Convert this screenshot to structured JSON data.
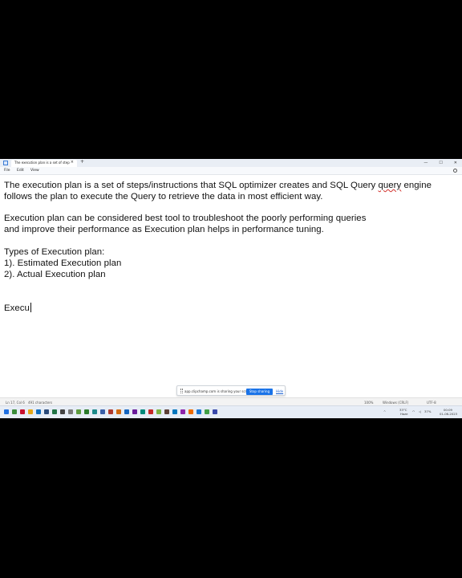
{
  "window": {
    "tab_title": "The execution plan is a set of step",
    "tab_close": "×",
    "new_tab": "+",
    "minimize": "—",
    "maximize": "☐",
    "close": "✕"
  },
  "menu": {
    "items": [
      "File",
      "Edit",
      "View"
    ]
  },
  "editor": {
    "lines": [
      "The execution plan is a set of steps/instructions that SQL optimizer creates and SQL Query ",
      "follows the plan to execute the Query to retrieve the data in most efficient way.",
      "Execution plan can be considered best tool to troubleshoot the poorly performing queries",
      "and improve their performance as Execution plan helps in performance tuning.",
      "Types of Execution plan:",
      "1). Estimated Execution plan",
      "2). Actual Execution plan",
      "Execu"
    ],
    "line0_squiggle": "query",
    "line0_tail": " engine"
  },
  "share_banner": {
    "text": "app.clipchamp.com is sharing your screen.",
    "stop_label": "Stop sharing",
    "hide_label": "Hide"
  },
  "status": {
    "position": "Ln 17, Col 6",
    "characters": "491 characters",
    "zoom": "100%",
    "line_ending": "Windows (CRLF)",
    "encoding": "UTF-8"
  },
  "taskbar": {
    "weather_temp": "33°C",
    "weather_text": "Haze",
    "chevron": "^",
    "battery": "37%",
    "time": "00:09",
    "date": "01-06-2023"
  },
  "colors": {
    "accent": "#1a73e8",
    "spell_error": "#d2322d",
    "taskbar": "#e7edf6"
  }
}
